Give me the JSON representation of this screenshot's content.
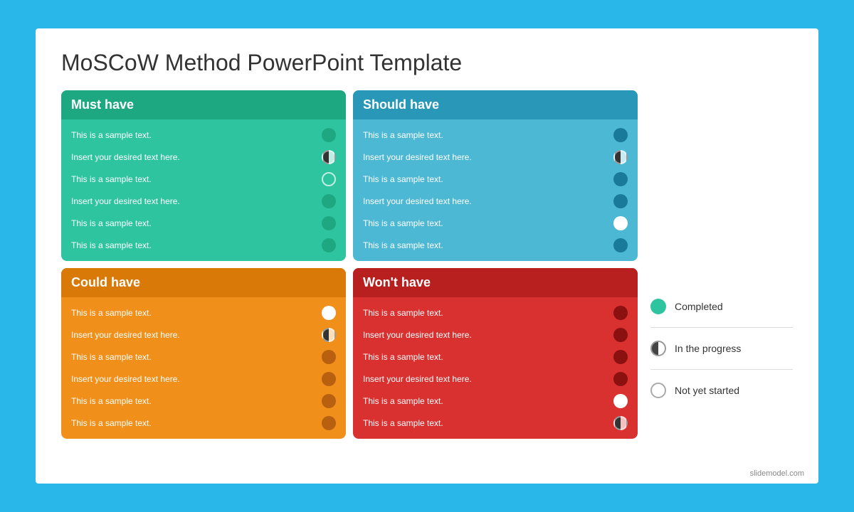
{
  "slide": {
    "title": "MoSCoW Method PowerPoint Template",
    "watermark": "slidemodel.com"
  },
  "cards": [
    {
      "id": "must-have",
      "class": "must-have",
      "header": "Must have",
      "rows": [
        {
          "text": "This is a sample text.",
          "icon": "full"
        },
        {
          "text": "Insert your desired text here.",
          "icon": "half"
        },
        {
          "text": "This is a sample text.",
          "icon": "empty"
        },
        {
          "text": "Insert your desired text here.",
          "icon": "full"
        },
        {
          "text": "This is a sample text.",
          "icon": "full"
        },
        {
          "text": "This is a sample text.",
          "icon": "full"
        }
      ]
    },
    {
      "id": "should-have",
      "class": "should-have",
      "header": "Should have",
      "rows": [
        {
          "text": "This is a sample text.",
          "icon": "full-dark"
        },
        {
          "text": "Insert your desired text here.",
          "icon": "half"
        },
        {
          "text": "This is a sample text.",
          "icon": "full-dark"
        },
        {
          "text": "Insert your desired text here.",
          "icon": "full-dark"
        },
        {
          "text": "This is a sample text.",
          "icon": "empty"
        },
        {
          "text": "This is a sample text.",
          "icon": "full-dark"
        }
      ]
    },
    {
      "id": "could-have",
      "class": "could-have",
      "header": "Could have",
      "rows": [
        {
          "text": "This is a sample text.",
          "icon": "empty"
        },
        {
          "text": "Insert your desired text here.",
          "icon": "half"
        },
        {
          "text": "This is a sample text.",
          "icon": "dark-orange"
        },
        {
          "text": "Insert your desired text here.",
          "icon": "dark-orange"
        },
        {
          "text": "This is a sample text.",
          "icon": "dark-orange"
        },
        {
          "text": "This is a sample text.",
          "icon": "dark-orange"
        }
      ]
    },
    {
      "id": "wont-have",
      "class": "wont-have",
      "header": "Won't have",
      "rows": [
        {
          "text": "This is a sample text.",
          "icon": "dark-red"
        },
        {
          "text": "Insert your desired text here.",
          "icon": "dark-red"
        },
        {
          "text": "This is a sample text.",
          "icon": "dark-red"
        },
        {
          "text": "Insert your desired text here.",
          "icon": "dark-red"
        },
        {
          "text": "This is a sample text.",
          "icon": "white"
        },
        {
          "text": "This is a sample text.",
          "icon": "half-white"
        }
      ]
    }
  ],
  "legend": {
    "items": [
      {
        "id": "completed",
        "icon": "full-green",
        "label": "Completed"
      },
      {
        "id": "in-progress",
        "icon": "half",
        "label": "In the progress"
      },
      {
        "id": "not-started",
        "icon": "empty",
        "label": "Not yet started"
      }
    ]
  }
}
